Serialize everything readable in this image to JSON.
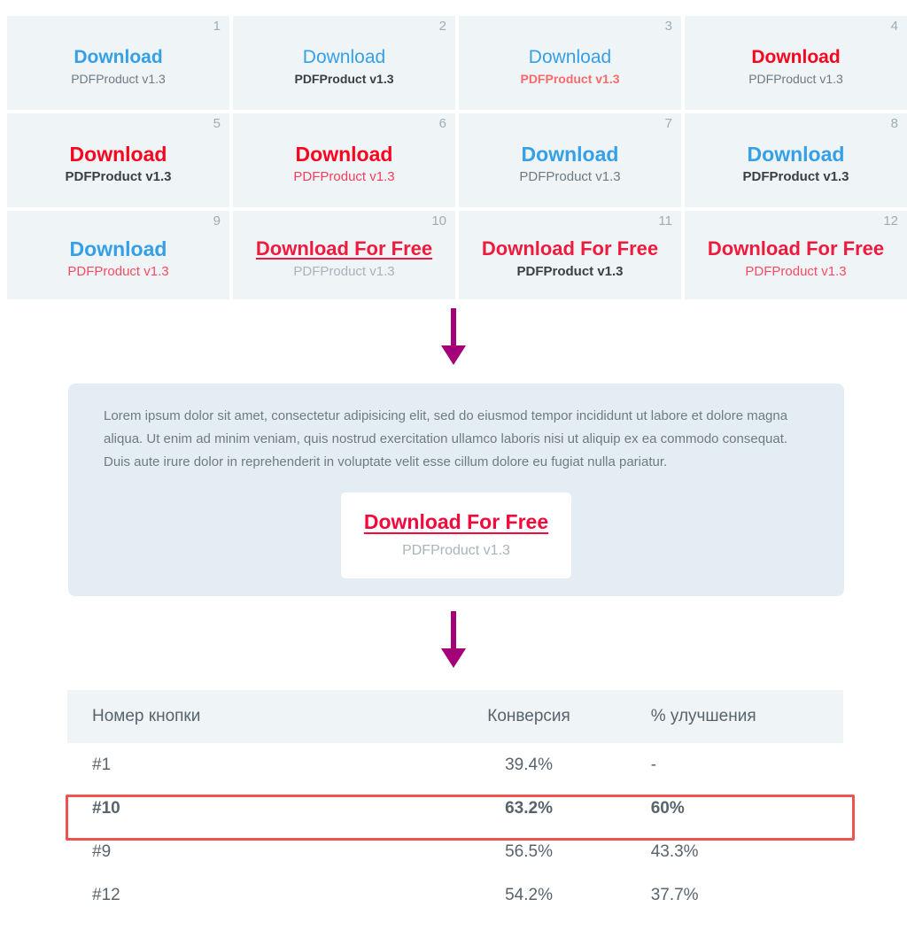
{
  "grid": {
    "cells": [
      {
        "number": "1",
        "main": "Download",
        "sub": "PDFProduct v1.3",
        "size": "sz-s",
        "main_class": "c-blue w-bold",
        "sub_class": "c-gray w-norm"
      },
      {
        "number": "2",
        "main": "Download",
        "sub": "PDFProduct v1.3",
        "size": "sz-s",
        "main_class": "c-blue w-norm",
        "sub_class": "c-dark w-bold"
      },
      {
        "number": "3",
        "main": "Download",
        "sub": "PDFProduct v1.3",
        "size": "sz-s",
        "main_class": "c-blue w-norm",
        "sub_class": "c-salmon w-bold"
      },
      {
        "number": "4",
        "main": "Download",
        "sub": "PDFProduct v1.3",
        "size": "sz-s",
        "main_class": "c-red w-bold",
        "sub_class": "c-gray w-norm"
      },
      {
        "number": "5",
        "main": "Download",
        "sub": "PDFProduct v1.3",
        "size": "sz-m",
        "main_class": "c-red w-bold",
        "sub_class": "c-dark w-bold"
      },
      {
        "number": "6",
        "main": "Download",
        "sub": "PDFProduct v1.3",
        "size": "sz-m",
        "main_class": "c-red w-bold",
        "sub_class": "c-lightred w-norm"
      },
      {
        "number": "7",
        "main": "Download",
        "sub": "PDFProduct v1.3",
        "size": "sz-m",
        "main_class": "c-blue w-bold",
        "sub_class": "c-gray w-norm"
      },
      {
        "number": "8",
        "main": "Download",
        "sub": "PDFProduct v1.3",
        "size": "sz-m",
        "main_class": "c-blue w-bold",
        "sub_class": "c-dark w-bold"
      },
      {
        "number": "9",
        "main": "Download",
        "sub": "PDFProduct v1.3",
        "size": "sz-m",
        "main_class": "c-blue w-bold",
        "sub_class": "c-pinkred w-norm"
      },
      {
        "number": "10",
        "main": "Download For Free",
        "sub": "PDFProduct v1.3",
        "size": "sz-l",
        "main_class": "c-crimson w-bold u-line",
        "sub_class": "c-graylt w-norm"
      },
      {
        "number": "11",
        "main": "Download For Free",
        "sub": "PDFProduct v1.3",
        "size": "sz-l",
        "main_class": "c-crimson w-bold",
        "sub_class": "c-dark w-bold"
      },
      {
        "number": "12",
        "main": "Download For Free",
        "sub": "PDFProduct v1.3",
        "size": "sz-l",
        "main_class": "c-crimson w-bold",
        "sub_class": "c-pinkred w-norm"
      }
    ]
  },
  "arrows": {
    "color": "#A3007A",
    "first_label": "down-arrow",
    "second_label": "down-arrow"
  },
  "panel": {
    "background": "#e4edf3",
    "lorem": "Lorem ipsum dolor sit amet, consectetur adipisicing elit, sed do eiusmod tempor incididunt ut labore et dolore magna aliqua. Ut enim ad minim veniam, quis nostrud exercitation ullamco laboris nisi ut aliquip ex ea commodo consequat. Duis aute irure dolor in reprehenderit in voluptate velit esse cillum dolore eu fugiat nulla pariatur.",
    "cta_main": "Download For Free",
    "cta_sub": "PDFProduct v1.3"
  },
  "table": {
    "headers": {
      "button_number": "Номер кнопки",
      "conversion": "Конверсия",
      "improvement": "% улучшения"
    },
    "highlight_color": "#ef5350",
    "rows": [
      {
        "name": "#1",
        "conversion": "39.4%",
        "improvement": "-",
        "highlight": false
      },
      {
        "name": "#10",
        "conversion": "63.2%",
        "improvement": "60%",
        "highlight": true
      },
      {
        "name": "#9",
        "conversion": "56.5%",
        "improvement": "43.3%",
        "highlight": false
      },
      {
        "name": "#12",
        "conversion": "54.2%",
        "improvement": "37.7%",
        "highlight": false
      }
    ]
  }
}
